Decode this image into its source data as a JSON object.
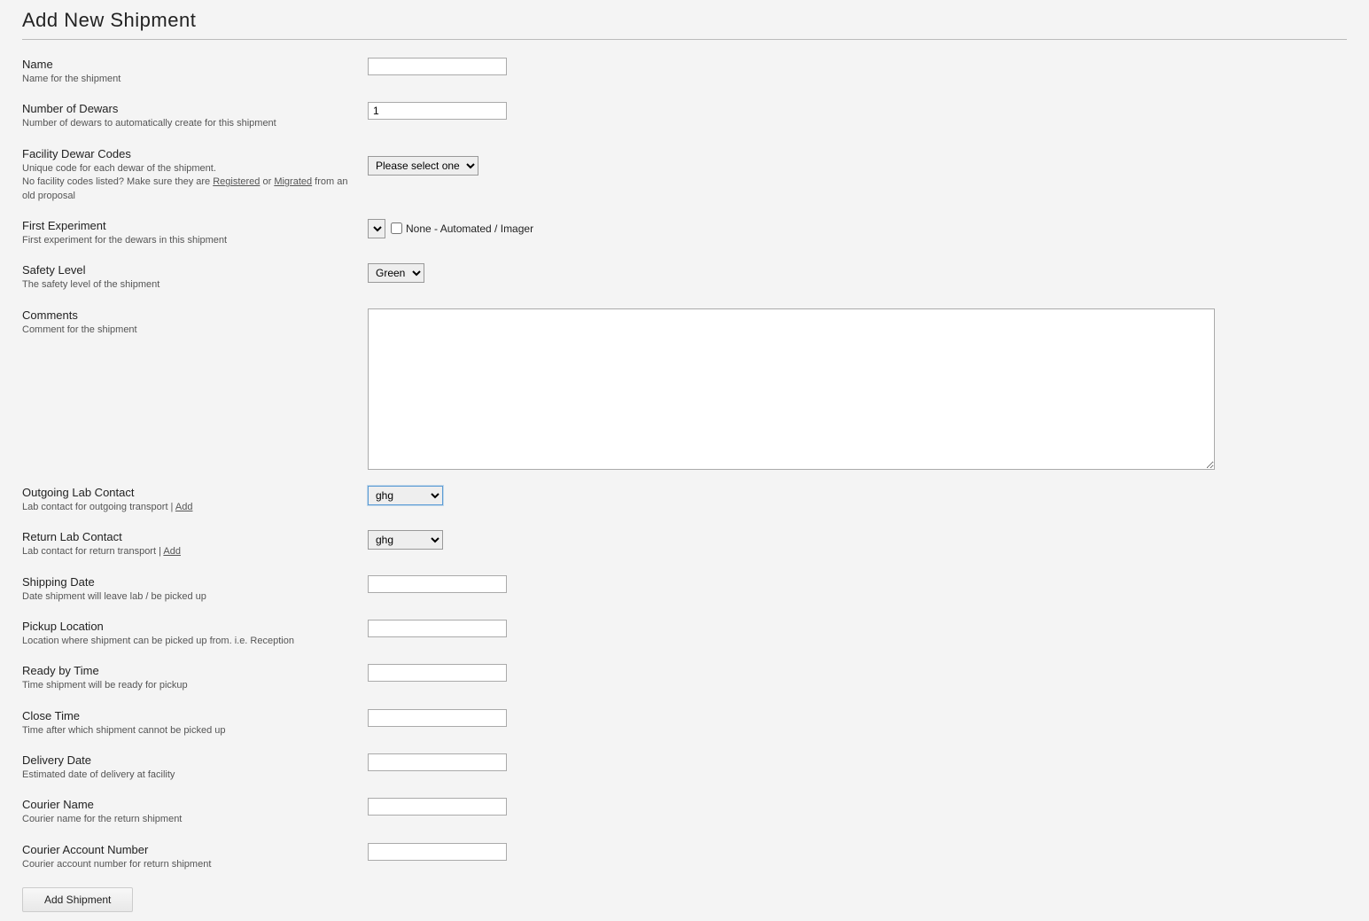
{
  "page": {
    "title": "Add New Shipment"
  },
  "fields": {
    "name": {
      "label": "Name",
      "desc": "Name for the shipment",
      "value": ""
    },
    "num_dewars": {
      "label": "Number of Dewars",
      "desc": "Number of dewars to automatically create for this shipment",
      "value": "1"
    },
    "facility_codes": {
      "label": "Facility Dewar Codes",
      "desc_prefix": "Unique code for each dewar of the shipment.",
      "desc_line2a": "No facility codes listed? Make sure they are ",
      "link_registered": "Registered",
      "desc_or": " or ",
      "link_migrated": "Migrated",
      "desc_suffix": " from an old proposal",
      "select_placeholder": "Please select one"
    },
    "first_experiment": {
      "label": "First Experiment",
      "desc": "First experiment for the dewars in this shipment",
      "checkbox_label": "None - Automated / Imager"
    },
    "safety_level": {
      "label": "Safety Level",
      "desc": "The safety level of the shipment",
      "value": "Green"
    },
    "comments": {
      "label": "Comments",
      "desc": "Comment for the shipment",
      "value": ""
    },
    "outgoing_contact": {
      "label": "Outgoing Lab Contact",
      "desc_prefix": "Lab contact for outgoing transport | ",
      "link_add": "Add",
      "value": "ghg"
    },
    "return_contact": {
      "label": "Return Lab Contact",
      "desc_prefix": "Lab contact for return transport | ",
      "link_add": "Add",
      "value": "ghg"
    },
    "shipping_date": {
      "label": "Shipping Date",
      "desc": "Date shipment will leave lab / be picked up",
      "value": ""
    },
    "pickup_location": {
      "label": "Pickup Location",
      "desc": "Location where shipment can be picked up from. i.e. Reception",
      "value": ""
    },
    "ready_by": {
      "label": "Ready by Time",
      "desc": "Time shipment will be ready for pickup",
      "value": ""
    },
    "close_time": {
      "label": "Close Time",
      "desc": "Time after which shipment cannot be picked up",
      "value": ""
    },
    "delivery_date": {
      "label": "Delivery Date",
      "desc": "Estimated date of delivery at facility",
      "value": ""
    },
    "courier_name": {
      "label": "Courier Name",
      "desc": "Courier name for the return shipment",
      "value": ""
    },
    "courier_account": {
      "label": "Courier Account Number",
      "desc": "Courier account number for return shipment",
      "value": ""
    }
  },
  "actions": {
    "submit": "Add Shipment"
  }
}
